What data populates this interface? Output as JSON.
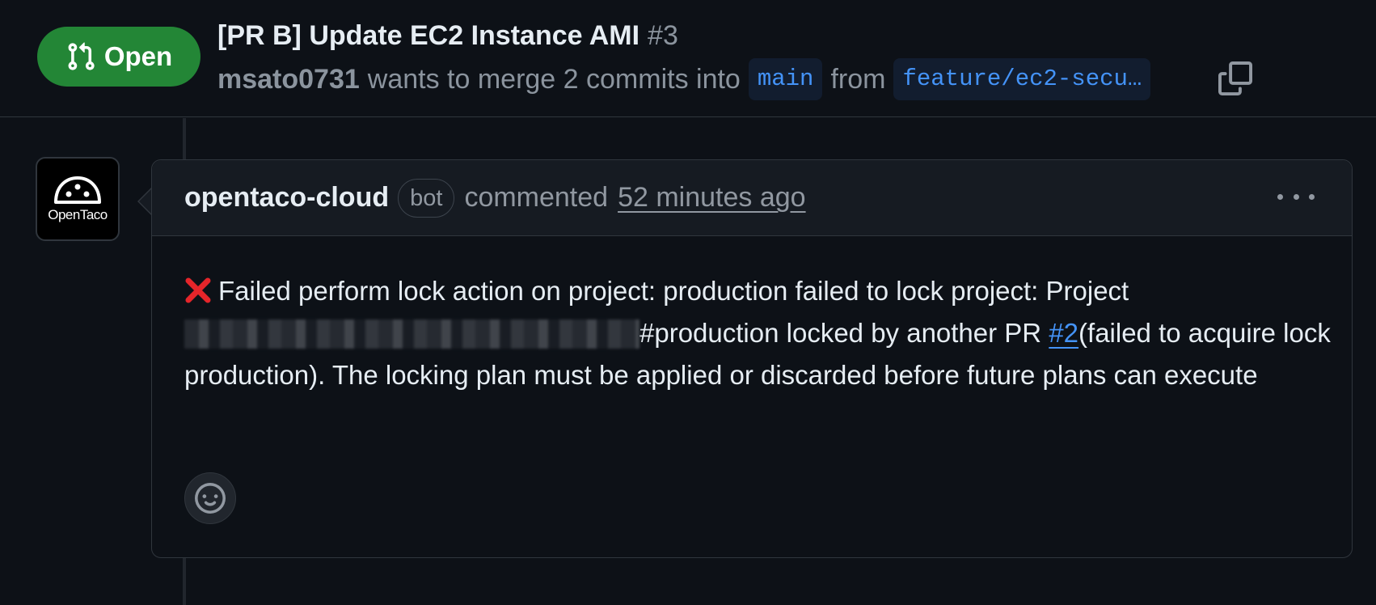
{
  "pr": {
    "state": "Open",
    "title": "[PR B] Update EC2 Instance AMI",
    "number": "#3",
    "author": "msato0731",
    "merge_text": "wants to merge 2 commits into",
    "base_branch": "main",
    "from_text": "from",
    "head_branch": "feature/ec2-secu…"
  },
  "comment": {
    "author": "opentaco-cloud",
    "badge": "bot",
    "action": "commented",
    "timestamp": "52 minutes ago",
    "avatar_text": "OpenTaco",
    "body_part1": "Failed perform lock action on project: production failed to lock project: Project ",
    "body_part2": "#production locked by another PR ",
    "pr_link": "#2",
    "body_part3": "(failed to acquire lock production). The locking plan must be applied or discarded before future plans can execute"
  },
  "icons": {
    "state": "git-pull-request-icon",
    "copy": "copy-icon",
    "more": "kebab-horizontal-icon",
    "error": "cross-mark-icon",
    "reaction": "smiley-icon"
  },
  "colors": {
    "open_green": "#238636",
    "link_blue": "#4493f8",
    "error_red": "#e5252a"
  }
}
